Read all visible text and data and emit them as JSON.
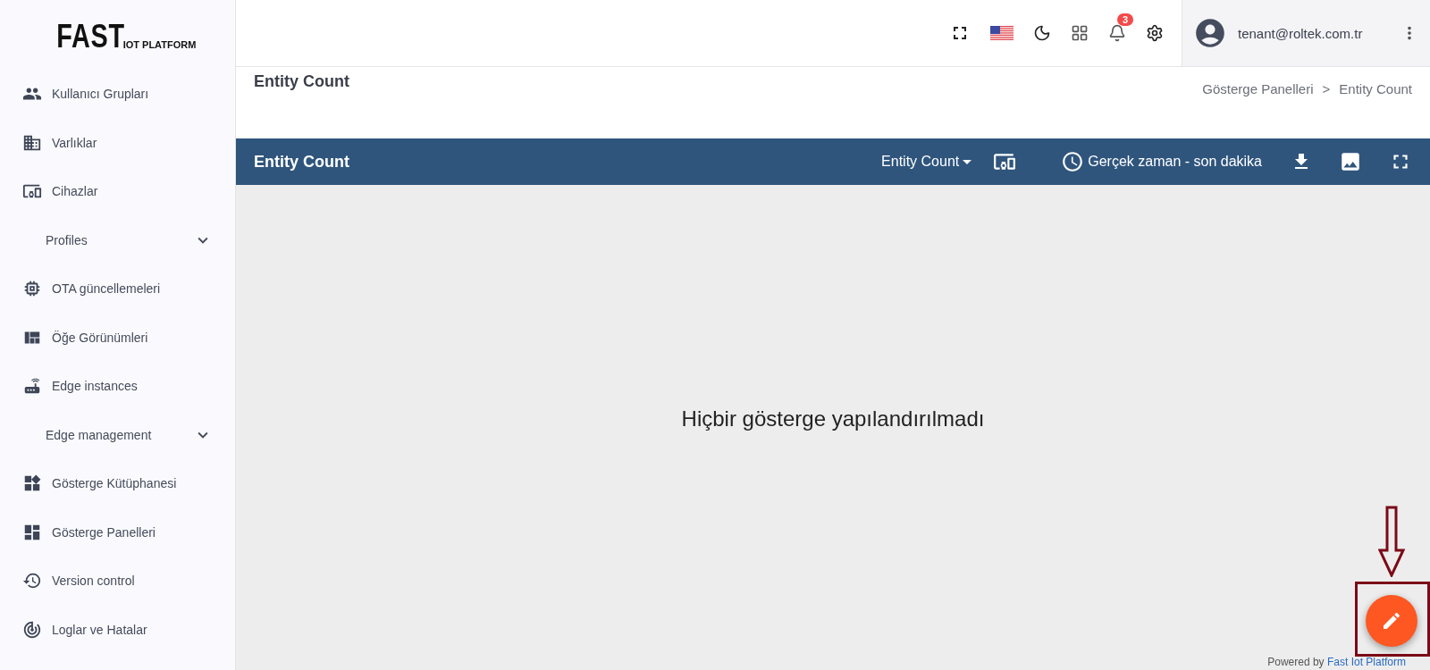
{
  "logo": {
    "main": "FAST",
    "sub": "IOT PLATFORM"
  },
  "sidebar": {
    "items": [
      {
        "label": "Kullanıcı Grupları",
        "kind": "link"
      },
      {
        "label": "Varlıklar",
        "kind": "link"
      },
      {
        "label": "Cihazlar",
        "kind": "link"
      },
      {
        "label": "Profiles",
        "kind": "section",
        "expanded": false
      },
      {
        "label": "OTA güncellemeleri",
        "kind": "link"
      },
      {
        "label": "Öğe Görünümleri",
        "kind": "link"
      },
      {
        "label": "Edge instances",
        "kind": "link"
      },
      {
        "label": "Edge management",
        "kind": "section",
        "expanded": false
      },
      {
        "label": "Gösterge Kütüphanesi",
        "kind": "link"
      },
      {
        "label": "Gösterge Panelleri",
        "kind": "link"
      },
      {
        "label": "Version control",
        "kind": "link"
      },
      {
        "label": "Loglar ve Hatalar",
        "kind": "link"
      }
    ]
  },
  "topbar": {
    "notification_count": "3",
    "user": "tenant@roltek.com.tr"
  },
  "page": {
    "title": "Entity Count",
    "breadcrumb": [
      "Gösterge Panelleri",
      ">",
      "Entity Count"
    ]
  },
  "dashboard": {
    "title": "Entity Count",
    "state_selector": "Entity Count",
    "timewindow": "Gerçek zaman - son dakika",
    "empty_message": "Hiçbir gösterge yapılandırılmadı"
  },
  "footer": {
    "prefix": "Powered by",
    "link": "Fast Iot Platform"
  }
}
